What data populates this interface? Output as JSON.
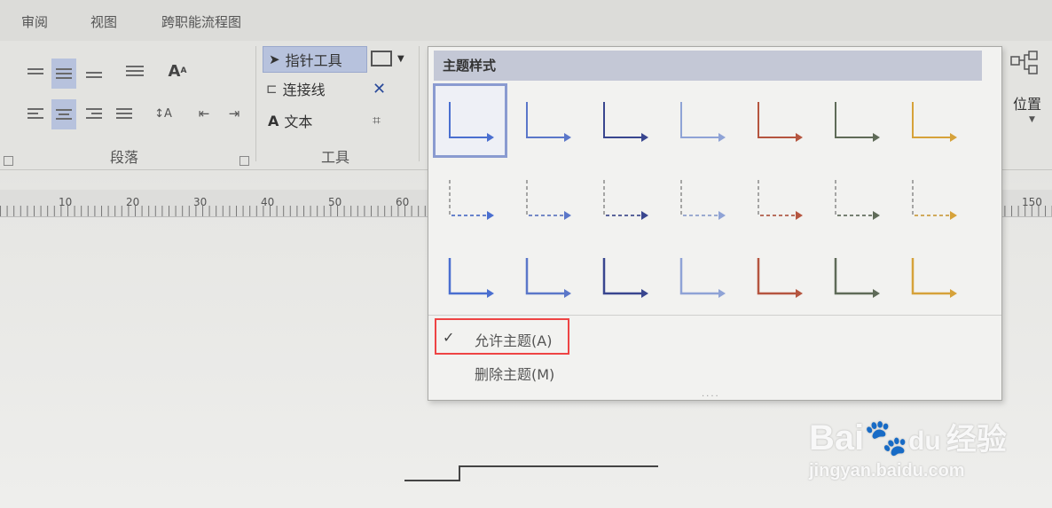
{
  "ribbon_tabs": [
    "审阅",
    "视图",
    "跨职能流程图"
  ],
  "groups": {
    "paragraph_label": "段落",
    "tools_label": "工具",
    "position_label": "位置"
  },
  "tools": {
    "pointer": "指针工具",
    "connector": "连接线",
    "text": "文本"
  },
  "ruler_numbers": [
    "10",
    "20",
    "30",
    "40",
    "50",
    "60",
    "150"
  ],
  "theme_panel": {
    "title": "主题样式",
    "allow_theme": "允许主题(A)",
    "delete_theme": "删除主题(M)",
    "swatch_colors": [
      "#4a6fd0",
      "#5b77c9",
      "#39468f",
      "#8fa3d6",
      "#b5553f",
      "#5f6b58",
      "#d6a23a"
    ]
  },
  "watermark": {
    "brand": "Bai",
    "du": "du",
    "cn": "经验",
    "url": "jingyan.baidu.com"
  }
}
